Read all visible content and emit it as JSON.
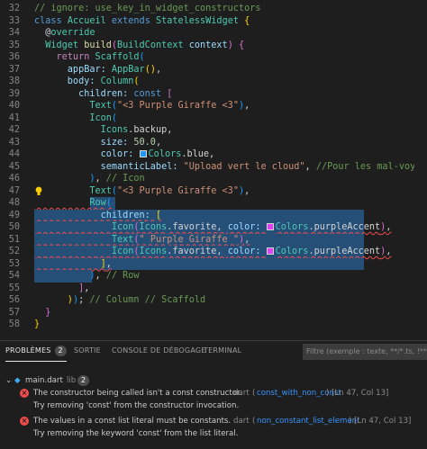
{
  "editor": {
    "lines": [
      {
        "n": "32",
        "t": [
          [
            "cmt",
            "// ignore: use_key_in_widget_constructors"
          ]
        ]
      },
      {
        "n": "33",
        "t": [
          [
            "kw",
            "class "
          ],
          [
            "cls",
            "Accueil "
          ],
          [
            "kw",
            "extends "
          ],
          [
            "cls",
            "StatelessWidget "
          ],
          [
            "b1",
            "{"
          ]
        ]
      },
      {
        "n": "34",
        "t": [
          [
            "",
            "  @"
          ],
          [
            "cls",
            "override"
          ]
        ]
      },
      {
        "n": "35",
        "t": [
          [
            "cls",
            "  Widget "
          ],
          [
            "fn",
            "build"
          ],
          [
            "b2",
            "("
          ],
          [
            "cls",
            "BuildContext "
          ],
          [
            "prm",
            "context"
          ],
          [
            "b2",
            ")"
          ],
          [
            "b2",
            " {"
          ]
        ]
      },
      {
        "n": "36",
        "t": [
          [
            "ctl",
            "    return "
          ],
          [
            "cls",
            "Scaffold"
          ],
          [
            "b3",
            "("
          ]
        ]
      },
      {
        "n": "37",
        "t": [
          [
            "prm",
            "      appBar: "
          ],
          [
            "cls",
            "AppBar"
          ],
          [
            "b1",
            "()"
          ],
          [
            "",
            ","
          ]
        ]
      },
      {
        "n": "38",
        "t": [
          [
            "prm",
            "      body: "
          ],
          [
            "cls",
            "Column"
          ],
          [
            "b1",
            "("
          ]
        ]
      },
      {
        "n": "39",
        "t": [
          [
            "prm",
            "        children: "
          ],
          [
            "kw",
            "const "
          ],
          [
            "b2",
            "["
          ]
        ]
      },
      {
        "n": "40",
        "t": [
          [
            "cls",
            "          Text"
          ],
          [
            "b3",
            "("
          ],
          [
            "str",
            "\"<3 Purple Giraffe <3\""
          ],
          [
            "b3",
            ")"
          ],
          [
            "",
            ","
          ]
        ]
      },
      {
        "n": "41",
        "t": [
          [
            "cls",
            "          Icon"
          ],
          [
            "b3",
            "("
          ]
        ]
      },
      {
        "n": "42",
        "t": [
          [
            "cls",
            "            Icons"
          ],
          [
            "",
            ".backup,"
          ]
        ]
      },
      {
        "n": "43",
        "t": [
          [
            "prm",
            "            size: "
          ],
          [
            "num",
            "50.0"
          ],
          [
            "",
            ","
          ]
        ]
      },
      {
        "n": "44",
        "t": [
          [
            "prm",
            "            color: "
          ],
          [
            "sw",
            "#2196f3"
          ],
          [
            "cls",
            "Colors"
          ],
          [
            "",
            ".blue,"
          ]
        ]
      },
      {
        "n": "45",
        "t": [
          [
            "prm",
            "            semanticLabel: "
          ],
          [
            "str",
            "\"Upload vert le cloud\""
          ],
          [
            "",
            ", "
          ],
          [
            "cmt",
            "//Pour les mal-voyants"
          ]
        ]
      },
      {
        "n": "46",
        "t": [
          [
            "b3",
            "          )"
          ],
          [
            "",
            ", "
          ],
          [
            "cmt",
            "// Icon"
          ]
        ]
      },
      {
        "n": "47",
        "t": [
          [
            "cls",
            "          Text"
          ],
          [
            "b3",
            "("
          ],
          [
            "str",
            "\"<3 Purple Giraffe <3\""
          ],
          [
            "b3",
            ")"
          ],
          [
            "",
            ","
          ]
        ]
      },
      {
        "n": "48",
        "t": [
          [
            "cls",
            "          Row"
          ],
          [
            "b3",
            "("
          ]
        ]
      },
      {
        "n": "49",
        "t": [
          [
            "prm",
            "            children: "
          ],
          [
            "b1",
            "["
          ]
        ]
      },
      {
        "n": "50",
        "t": [
          [
            "cls",
            "              Icon"
          ],
          [
            "b2",
            "("
          ],
          [
            "cls",
            "Icons"
          ],
          [
            "",
            ".favorite, "
          ],
          [
            "prm",
            "color: "
          ],
          [
            "sw",
            "#e040fb"
          ],
          [
            "cls",
            "Colors"
          ],
          [
            "",
            ".purpleAccent"
          ],
          [
            "b2",
            ")"
          ],
          [
            "",
            ","
          ]
        ]
      },
      {
        "n": "51",
        "t": [
          [
            "cls",
            "              Text"
          ],
          [
            "b2",
            "("
          ],
          [
            "str",
            "\" Purple Giraffe \""
          ],
          [
            "b2",
            ")"
          ],
          [
            "",
            ","
          ]
        ]
      },
      {
        "n": "52",
        "t": [
          [
            "cls",
            "              Icon"
          ],
          [
            "b2",
            "("
          ],
          [
            "cls",
            "Icons"
          ],
          [
            "",
            ".favorite, "
          ],
          [
            "prm",
            "color: "
          ],
          [
            "sw",
            "#e040fb"
          ],
          [
            "cls",
            "Colors"
          ],
          [
            "",
            ".purpleAccent"
          ],
          [
            "b2",
            ")"
          ],
          [
            "",
            ","
          ]
        ]
      },
      {
        "n": "53",
        "t": [
          [
            "b1",
            "            ]"
          ],
          [
            "",
            ","
          ]
        ]
      },
      {
        "n": "54",
        "t": [
          [
            "b3",
            "          )"
          ],
          [
            "",
            ", "
          ],
          [
            "cmt",
            "// Row"
          ]
        ]
      },
      {
        "n": "55",
        "t": [
          [
            "b2",
            "        ]"
          ],
          [
            "",
            ","
          ]
        ]
      },
      {
        "n": "56",
        "t": [
          [
            "b1",
            "      )"
          ],
          [
            "b3",
            ")"
          ],
          [
            "",
            ";"
          ],
          [
            "cmt",
            " // Column // Scaffold"
          ]
        ]
      },
      {
        "n": "57",
        "t": [
          [
            "b2",
            "  }"
          ]
        ]
      },
      {
        "n": "58",
        "t": [
          [
            "b1",
            "}"
          ]
        ]
      }
    ]
  },
  "panel": {
    "tabs": [
      {
        "label": "PROBLÈMES",
        "badge": "2"
      },
      {
        "label": "SORTIE"
      },
      {
        "label": "CONSOLE DE DÉBOGAGE"
      },
      {
        "label": "TERMINAL"
      }
    ],
    "filter_placeholder": "Filtre (exemple : texte, **/*.ts, !**/no",
    "file": {
      "name": "main.dart",
      "folder": "lib",
      "count": "2"
    },
    "problems": [
      {
        "message": "The constructor being called isn't a const constructor.",
        "source": "dart",
        "code": "const_with_non_const",
        "location": "[Ln 47, Col 13]",
        "hint": "Try removing 'const' from the constructor invocation."
      },
      {
        "message": "The values in a const list literal must be constants.",
        "source": "dart",
        "code": "non_constant_list_element",
        "location": "[Ln 47, Col 13]",
        "hint": "Try removing the keyword 'const' from the list literal."
      }
    ]
  },
  "colors": {
    "error": "#f14c4c",
    "link": "#3794ff",
    "selection": "#264f78"
  }
}
